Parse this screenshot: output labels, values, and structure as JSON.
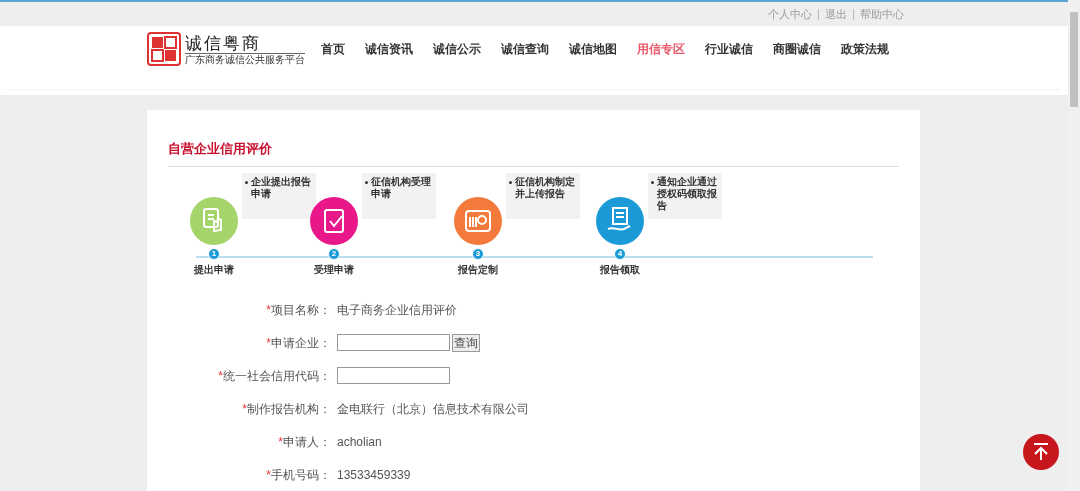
{
  "top_links": [
    "个人中心",
    "退出",
    "帮助中心"
  ],
  "logo": {
    "title": "诚信粤商",
    "subtitle": "广东商务诚信公共服务平台"
  },
  "nav": [
    {
      "label": "首页",
      "selected": false
    },
    {
      "label": "诚信资讯",
      "selected": false
    },
    {
      "label": "诚信公示",
      "selected": false
    },
    {
      "label": "诚信查询",
      "selected": false
    },
    {
      "label": "诚信地图",
      "selected": false
    },
    {
      "label": "用信专区",
      "selected": true
    },
    {
      "label": "行业诚信",
      "selected": false
    },
    {
      "label": "商圈诚信",
      "selected": false
    },
    {
      "label": "政策法规",
      "selected": false
    }
  ],
  "section_title": "自营企业信用评价",
  "steps": [
    {
      "number": "1",
      "label": "提出申请",
      "note": "企业提出报告申请",
      "color": "#a5d46a"
    },
    {
      "number": "2",
      "label": "受理申请",
      "note": "征信机构受理申请",
      "color": "#e8188a"
    },
    {
      "number": "3",
      "label": "报告定制",
      "note": "征信机构制定并上传报告",
      "color": "#f37a3a"
    },
    {
      "number": "4",
      "label": "报告领取",
      "note": "通知企业通过授权码领取报告",
      "color": "#1a9ad6"
    }
  ],
  "form": [
    {
      "kind": "text",
      "mark": "*",
      "label": "项目名称：",
      "value": "电子商务企业信用评价"
    },
    {
      "kind": "input_with_button",
      "mark": "*",
      "label": "申请企业：",
      "button": "查询"
    },
    {
      "kind": "input",
      "mark": "*",
      "label": "统一社会信用代码："
    },
    {
      "kind": "text",
      "mark": "*",
      "label": "制作报告机构：",
      "value": "金电联行（北京）信息技术有限公司"
    },
    {
      "kind": "text",
      "mark": "*",
      "label": "申请人：",
      "value": "acholian"
    },
    {
      "kind": "text",
      "mark": "*",
      "label": "手机号码：",
      "value": "13533459339"
    }
  ]
}
